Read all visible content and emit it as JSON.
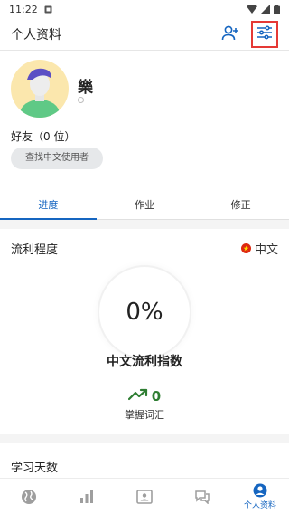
{
  "status_bar": {
    "time": "11:22"
  },
  "app_bar": {
    "title": "个人资料"
  },
  "profile": {
    "username": "樂",
    "friends_label": "好友（0 位）",
    "find_button": "查找中文使用者"
  },
  "tabs": [
    {
      "label": "进度",
      "active": true
    },
    {
      "label": "作业",
      "active": false
    },
    {
      "label": "修正",
      "active": false
    }
  ],
  "fluency": {
    "title": "流利程度",
    "language": "中文",
    "percent": "0%",
    "index_label": "中文流利指数",
    "vocab_count": "0",
    "vocab_label": "掌握词汇"
  },
  "study_days": {
    "title": "学习天数"
  },
  "bottom_nav": [
    {
      "icon": "globe-icon",
      "label": ""
    },
    {
      "icon": "stats-icon",
      "label": ""
    },
    {
      "icon": "contact-card-icon",
      "label": ""
    },
    {
      "icon": "chat-icon",
      "label": ""
    },
    {
      "icon": "profile-icon",
      "label": "个人资料",
      "active": true
    }
  ],
  "colors": {
    "accent": "#1565c0",
    "highlight_box": "#e53935",
    "vocab_green": "#2e7d32",
    "avatar_bg": "#fbe7ad",
    "avatar_body": "#5fc986",
    "avatar_hair": "#5b4fc4"
  }
}
